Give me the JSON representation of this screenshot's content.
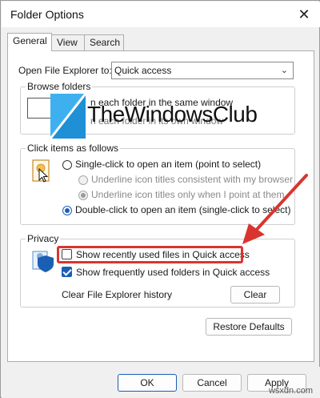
{
  "window": {
    "title": "Folder Options",
    "close_glyph": "✕"
  },
  "tabs": [
    {
      "label": "General",
      "active": true
    },
    {
      "label": "View",
      "active": false
    },
    {
      "label": "Search",
      "active": false
    }
  ],
  "open_to": {
    "label": "Open File Explorer to:",
    "value": "Quick access",
    "chevron": "⌄"
  },
  "browse": {
    "title": "Browse folders",
    "option1": "n each folder in the same window",
    "option2": "n each folder in its own window"
  },
  "watermark": {
    "text": "TheWindowsClub"
  },
  "click_items": {
    "title": "Click items as follows",
    "single": "Single-click to open an item (point to select)",
    "underline1": "Underline icon titles consistent with my browser",
    "underline2": "Underline icon titles only when I point at them",
    "double": "Double-click to open an item (single-click to select)"
  },
  "privacy": {
    "title": "Privacy",
    "recent_files": {
      "label": "Show recently used files in Quick access",
      "checked": false
    },
    "frequent_folders": {
      "label": "Show frequently used folders in Quick access",
      "checked": true
    },
    "clear_history_label": "Clear File Explorer history",
    "clear_button": "Clear"
  },
  "restore_defaults": "Restore Defaults",
  "footer": {
    "ok": "OK",
    "cancel": "Cancel",
    "apply": "Apply"
  },
  "site_mark": "wsxdn.com",
  "colors": {
    "accent": "#1a5fb4",
    "highlight": "#d9352f"
  }
}
